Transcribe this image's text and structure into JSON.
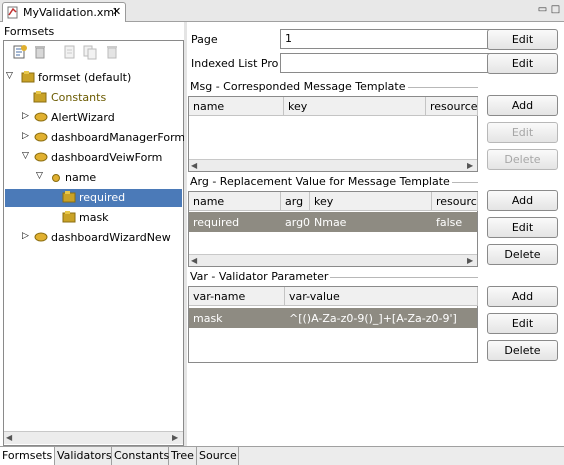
{
  "editor": {
    "tab_title": "MyValidation.xml",
    "close_glyph": "✕"
  },
  "window_controls": {
    "minimize": "▭",
    "maximize": "□"
  },
  "left": {
    "title": "Formsets",
    "tree": [
      {
        "label": "formset (default)",
        "expander": "▽"
      },
      {
        "label": "Constants",
        "expander": ""
      },
      {
        "label": "AlertWizard",
        "expander": "▷"
      },
      {
        "label": "dashboardManagerForm",
        "expander": "▷"
      },
      {
        "label": "dashboardVeiwForm",
        "expander": "▽"
      },
      {
        "label": "name",
        "expander": "▽"
      },
      {
        "label": "required",
        "expander": ""
      },
      {
        "label": "mask",
        "expander": ""
      },
      {
        "label": "dashboardWizardNew",
        "expander": "▷"
      }
    ],
    "scroll_left": "◀",
    "scroll_right": "▶"
  },
  "bottom_tabs": [
    "Formsets",
    "Validators",
    "Constants",
    "Tree",
    "Source"
  ],
  "page_field": {
    "label": "Page",
    "value": "1",
    "button": "Edit"
  },
  "indexed_field": {
    "label": "Indexed List Prope",
    "value": "",
    "button": "Edit"
  },
  "msg": {
    "title": "Msg - Corresponded Message Template",
    "columns": [
      "name",
      "key",
      "resource"
    ],
    "buttons": [
      "Add",
      "Edit",
      "Delete"
    ]
  },
  "arg": {
    "title": "Arg - Replacement Value for Message Template",
    "columns": [
      "name",
      "arg",
      "key",
      "resource"
    ],
    "rows": [
      [
        "required",
        "arg0",
        "Nmae",
        "false"
      ]
    ],
    "buttons": [
      "Add",
      "Edit",
      "Delete"
    ]
  },
  "var": {
    "title": "Var - Validator Parameter",
    "columns": [
      "var-name",
      "var-value"
    ],
    "rows": [
      [
        "mask",
        "^[()A-Za-z0-9()_]+[A-Za-z0-9']"
      ]
    ],
    "buttons": [
      "Add",
      "Edit",
      "Delete"
    ]
  },
  "colors": {
    "tree_selection": "#4b7ab8",
    "table_selection": "#8e8b82",
    "folder_icon": "#c9a227"
  }
}
